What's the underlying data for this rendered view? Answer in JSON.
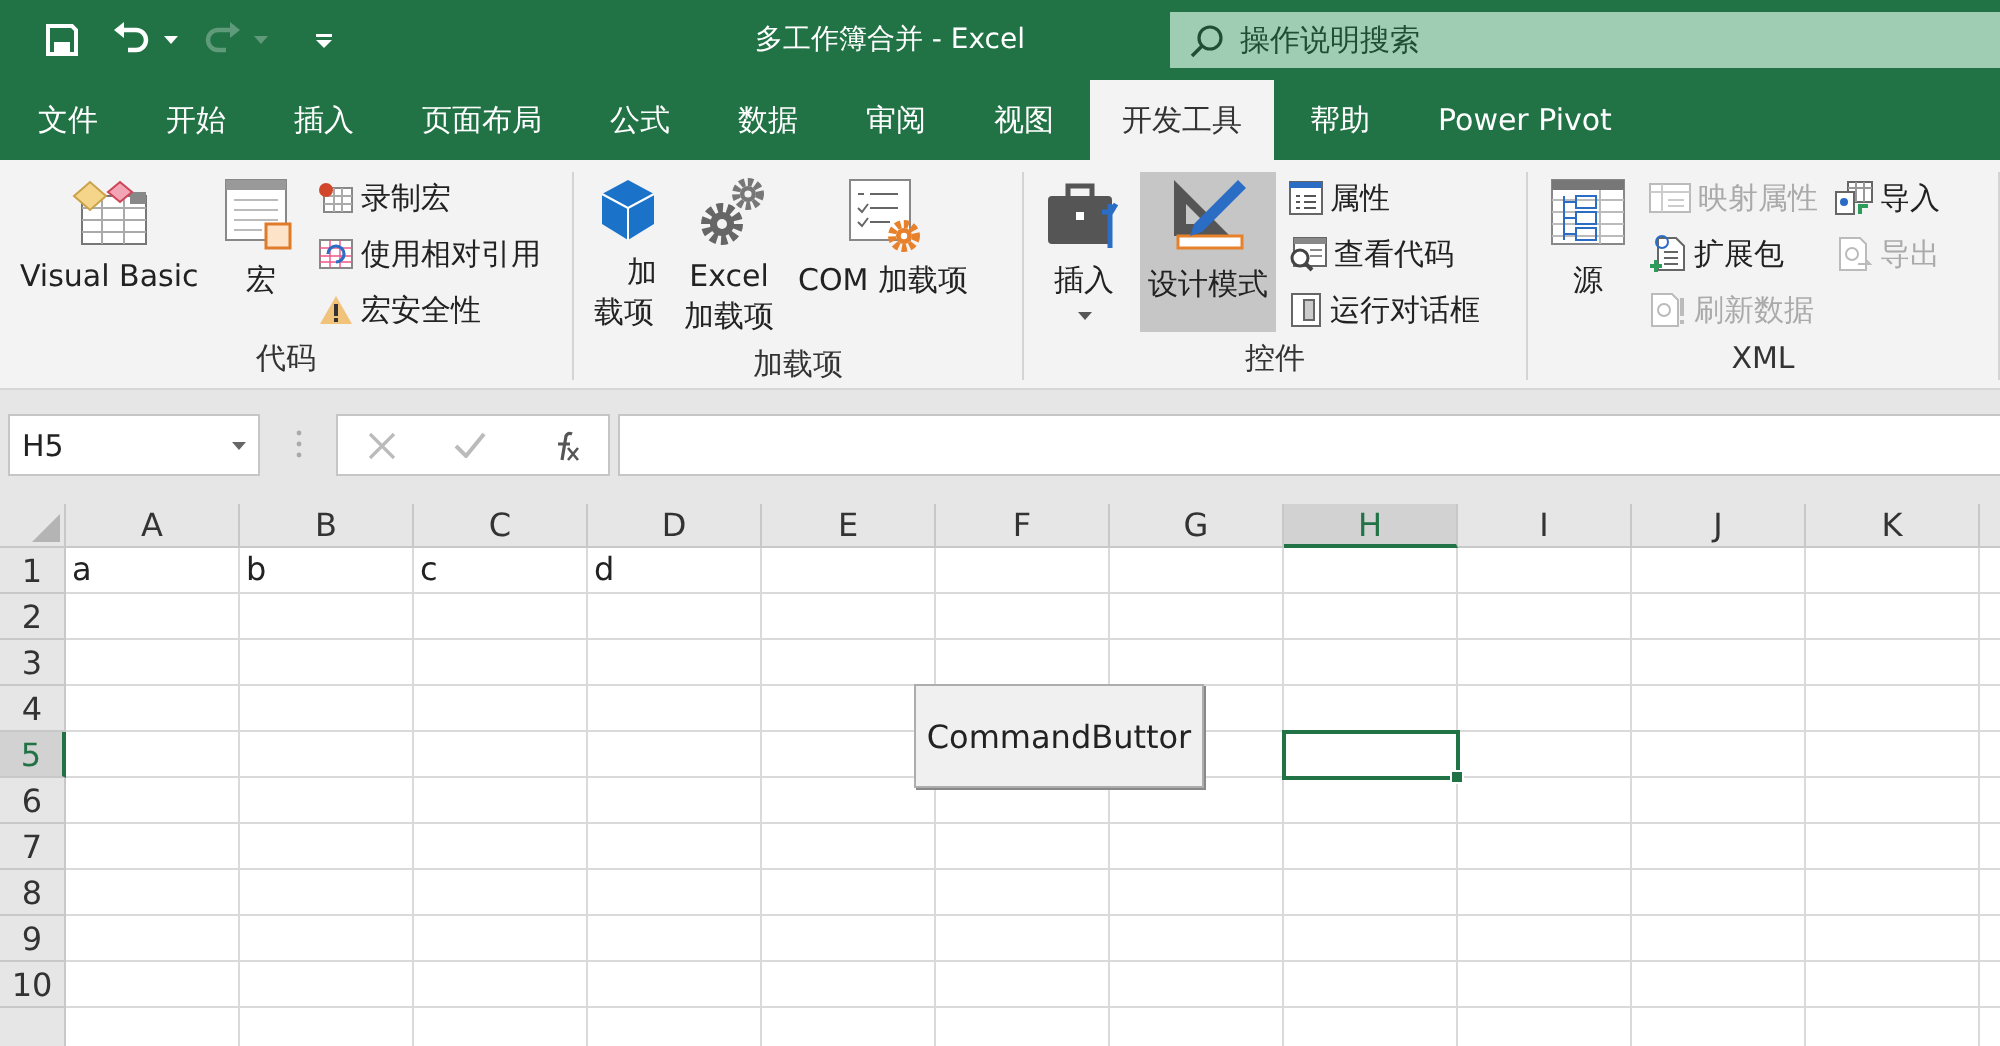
{
  "title_bar": {
    "title": "多工作簿合并 - Excel",
    "search": {
      "placeholder": "操作说明搜索"
    }
  },
  "tabs": [
    {
      "label": "文件",
      "selected": false
    },
    {
      "label": "开始",
      "selected": false
    },
    {
      "label": "插入",
      "selected": false
    },
    {
      "label": "页面布局",
      "selected": false
    },
    {
      "label": "公式",
      "selected": false
    },
    {
      "label": "数据",
      "selected": false
    },
    {
      "label": "审阅",
      "selected": false
    },
    {
      "label": "视图",
      "selected": false
    },
    {
      "label": "开发工具",
      "selected": true
    },
    {
      "label": "帮助",
      "selected": false
    },
    {
      "label": "Power Pivot",
      "selected": false
    }
  ],
  "ribbon": {
    "groups": [
      {
        "label": "代码",
        "items": [
          {
            "kind": "large",
            "label": "Visual Basic",
            "disabled": false,
            "pressed": false
          },
          {
            "kind": "large",
            "label": "宏",
            "disabled": false,
            "pressed": false
          },
          {
            "kind": "small",
            "label": "录制宏",
            "disabled": false
          },
          {
            "kind": "small",
            "label": "使用相对引用",
            "disabled": false
          },
          {
            "kind": "small",
            "label": "宏安全性",
            "disabled": false
          }
        ]
      },
      {
        "label": "加载项",
        "items": [
          {
            "kind": "large-wrap",
            "label": "加载项",
            "disabled": false,
            "pressed": false
          },
          {
            "kind": "large",
            "label": "Excel\n加载项",
            "disabled": false,
            "pressed": false
          },
          {
            "kind": "large",
            "label": "COM 加载项",
            "disabled": false,
            "pressed": false
          }
        ]
      },
      {
        "label": "控件",
        "items": [
          {
            "kind": "large-menu",
            "label": "插入",
            "disabled": false,
            "pressed": false
          },
          {
            "kind": "large",
            "label": "设计模式",
            "disabled": false,
            "pressed": true
          },
          {
            "kind": "small",
            "label": "属性",
            "disabled": false
          },
          {
            "kind": "small",
            "label": "查看代码",
            "disabled": false
          },
          {
            "kind": "small",
            "label": "运行对话框",
            "disabled": false
          }
        ]
      },
      {
        "label": "XML",
        "items": [
          {
            "kind": "large",
            "label": "源",
            "disabled": false,
            "pressed": false
          },
          {
            "kind": "small",
            "label": "映射属性",
            "disabled": true
          },
          {
            "kind": "small",
            "label": "扩展包",
            "disabled": false
          },
          {
            "kind": "small",
            "label": "刷新数据",
            "disabled": true
          },
          {
            "kind": "small",
            "label": "导入",
            "disabled": false
          },
          {
            "kind": "small",
            "label": "导出",
            "disabled": true
          }
        ]
      }
    ]
  },
  "formula_bar": {
    "name_box": "H5"
  },
  "sheet": {
    "columns": [
      {
        "label": "A",
        "selected": false
      },
      {
        "label": "B",
        "selected": false
      },
      {
        "label": "C",
        "selected": false
      },
      {
        "label": "D",
        "selected": false
      },
      {
        "label": "E",
        "selected": false
      },
      {
        "label": "F",
        "selected": false
      },
      {
        "label": "G",
        "selected": false
      },
      {
        "label": "H",
        "selected": true
      },
      {
        "label": "I",
        "selected": false
      },
      {
        "label": "J",
        "selected": false
      },
      {
        "label": "K",
        "selected": false
      }
    ],
    "rows": [
      {
        "label": "1",
        "selected": false,
        "cells": [
          "a",
          "b",
          "c",
          "d"
        ]
      },
      {
        "label": "2",
        "selected": false
      },
      {
        "label": "3",
        "selected": false
      },
      {
        "label": "4",
        "selected": false
      },
      {
        "label": "5",
        "selected": true
      },
      {
        "label": "6",
        "selected": false
      },
      {
        "label": "7",
        "selected": false
      },
      {
        "label": "8",
        "selected": false
      },
      {
        "label": "9",
        "selected": false
      },
      {
        "label": "10",
        "selected": false
      }
    ],
    "command_button": {
      "label": "CommandButtor"
    }
  }
}
